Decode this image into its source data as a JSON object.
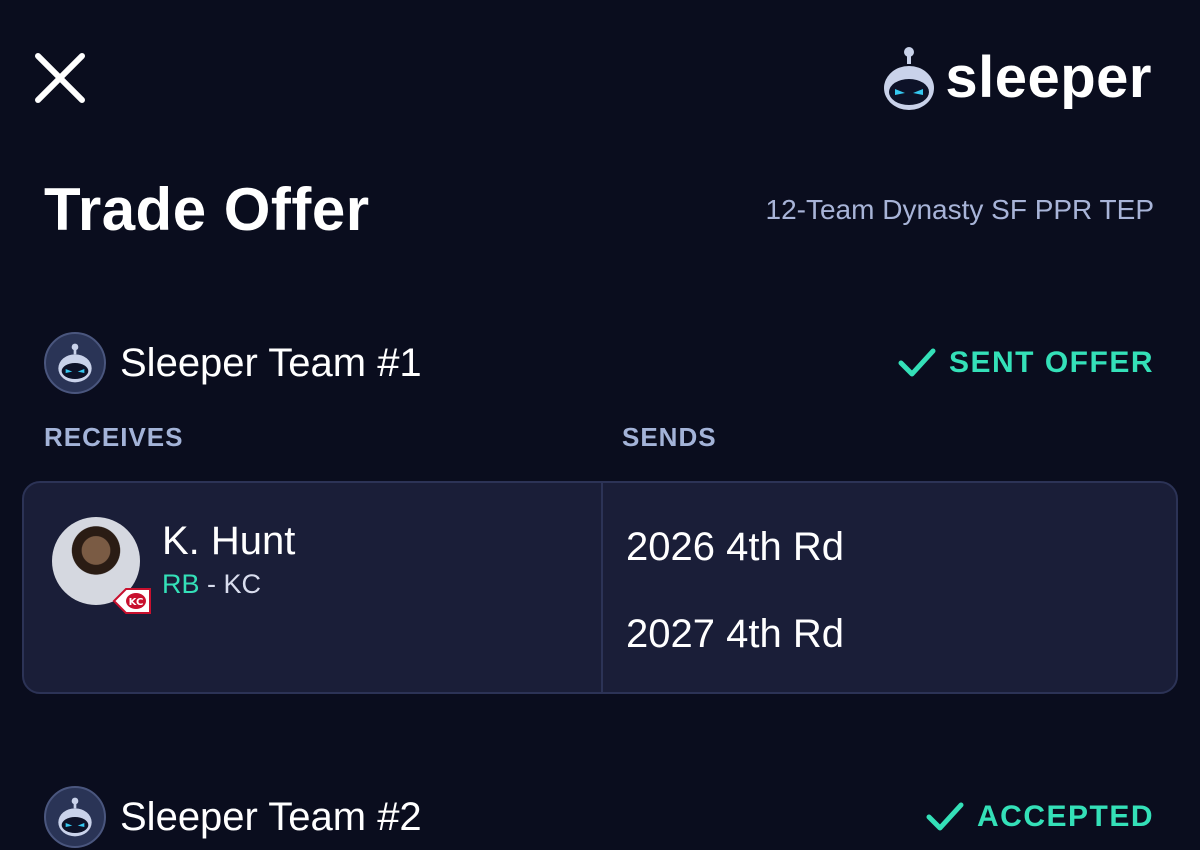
{
  "header": {
    "brand_name": "sleeper"
  },
  "title": "Trade Offer",
  "league": "12-Team Dynasty SF PPR TEP",
  "columns": {
    "receives": "RECEIVES",
    "sends": "SENDS"
  },
  "teams": [
    {
      "name": "Sleeper Team #1",
      "status": "SENT OFFER",
      "receives": [
        {
          "name": "K. Hunt",
          "position": "RB",
          "separator": " - ",
          "team": "KC"
        }
      ],
      "sends": [
        "2026 4th Rd",
        "2027 4th Rd"
      ]
    },
    {
      "name": "Sleeper Team #2",
      "status": "ACCEPTED"
    }
  ],
  "colors": {
    "background": "#0a0d1e",
    "card": "#1a1e38",
    "accent": "#34e0b8",
    "muted": "#a8b4d8"
  },
  "icons": {
    "close": "close-icon",
    "check": "checkmark-icon",
    "logo": "sleeper-robot-logo"
  }
}
